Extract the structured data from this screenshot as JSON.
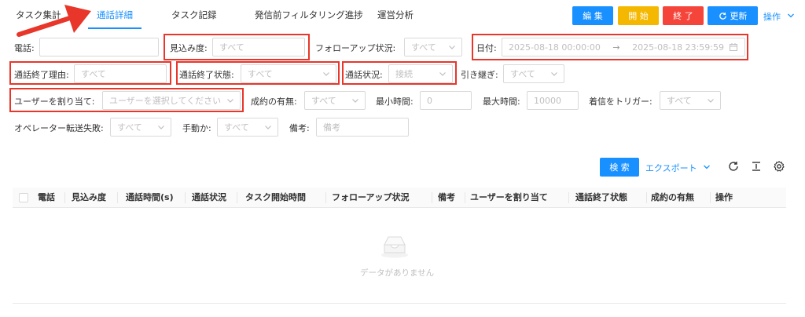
{
  "tabs": [
    {
      "label": "タスク集計"
    },
    {
      "label": "通話詳細"
    },
    {
      "label": "タスク記録"
    },
    {
      "label": "発信前フィルタリング進捗"
    },
    {
      "label": "運営分析"
    }
  ],
  "toolbar": {
    "edit_label": "編 集",
    "start_label": "開 始",
    "end_label": "終 了",
    "refresh_label": "更新",
    "ops_label": "操作"
  },
  "filters": {
    "phone": {
      "label": "電話:",
      "placeholder": ""
    },
    "prospect": {
      "label": "見込み度:",
      "value": "すべて"
    },
    "followup": {
      "label": "フォローアップ状況:",
      "value": "すべて"
    },
    "date": {
      "label": "日付:",
      "start": "2025-08-18 00:00:00",
      "end": "2025-08-18 23:59:59"
    },
    "end_reason": {
      "label": "通話終了理由:",
      "value": "すべて"
    },
    "end_status": {
      "label": "通話終了状態:",
      "value": "すべて"
    },
    "call_status": {
      "label": "通話状況:",
      "value": "接続"
    },
    "handover": {
      "label": "引き継ぎ:",
      "value": "すべて"
    },
    "assign_user": {
      "label": "ユーザーを割り当て:",
      "value": "ユーザーを選択してください"
    },
    "deal": {
      "label": "成約の有無:",
      "value": "すべて"
    },
    "min_time": {
      "label": "最小時間:",
      "value": "0"
    },
    "max_time": {
      "label": "最大時間:",
      "value": "10000"
    },
    "trigger": {
      "label": "着信をトリガー:",
      "value": "すべて"
    },
    "transfer_fail": {
      "label": "オペレーター転送失敗:",
      "value": "すべて"
    },
    "manual": {
      "label": "手動か:",
      "value": "すべて"
    },
    "memo": {
      "label": "備考:",
      "placeholder": "備考"
    }
  },
  "table_toolbar": {
    "search_label": "検 索",
    "export_label": "エクスポート"
  },
  "table": {
    "columns": [
      "電話",
      "見込み度",
      "通話時間(s)",
      "通話状況",
      "タスク開始時間",
      "フォローアップ状況",
      "備考",
      "ユーザーを割り当て",
      "通話終了状態",
      "成約の有無",
      "操作"
    ],
    "empty_text": "データがありません"
  },
  "colors": {
    "primary": "#1890ff",
    "warning": "#f5b800",
    "danger": "#f5443a",
    "highlight": "#e8362a"
  }
}
